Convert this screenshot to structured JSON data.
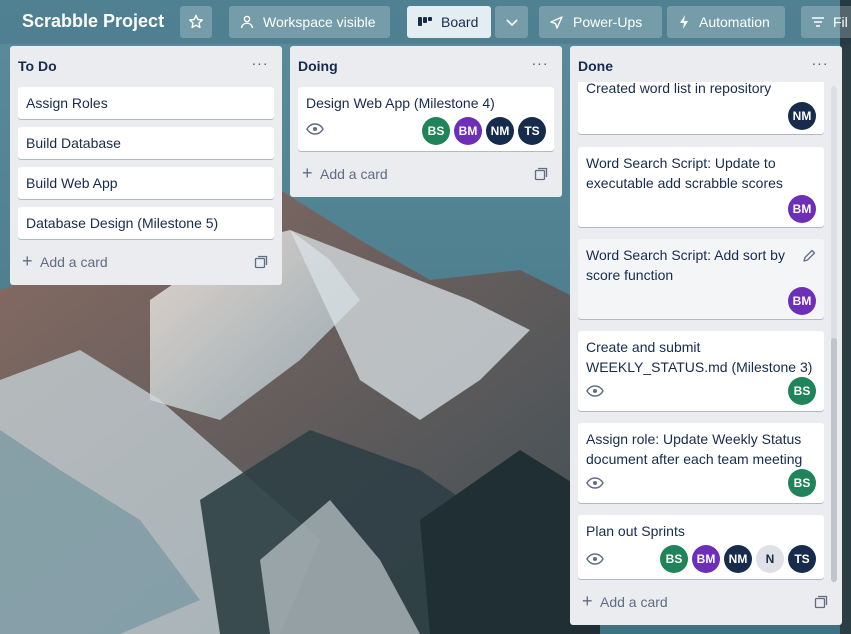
{
  "header": {
    "board_title": "Scrabble Project",
    "star_icon": "star-icon",
    "workspace_label": "Workspace visible",
    "board_label": "Board",
    "powerups_label": "Power-Ups",
    "automation_label": "Automation",
    "filter_label": "Fil"
  },
  "lists": {
    "todo": {
      "title": "To Do",
      "menu": "···",
      "cards": [
        "Assign Roles",
        "Build Database",
        "Build Web App",
        "Database Design (Milestone 5)"
      ],
      "add_card": "Add a card"
    },
    "doing": {
      "title": "Doing",
      "menu": "···",
      "cards": [
        {
          "text": "Design Web App (Milestone 4)",
          "members": [
            "BS",
            "BM",
            "NM",
            "TS"
          ]
        }
      ],
      "add_card": "Add a card"
    },
    "done": {
      "title": "Done",
      "menu": "···",
      "cards": [
        {
          "text": "Created word list in repository",
          "members": [
            "NM"
          ]
        },
        {
          "text": "Word Search Script: Update to executable add scrabble scores",
          "members": [
            "BM"
          ]
        },
        {
          "text": "Word Search Script: Add sort by score function",
          "members": [
            "BM"
          ]
        },
        {
          "text": "Create and submit WEEKLY_STATUS.md (Milestone 3)",
          "members": [
            "BS"
          ]
        },
        {
          "text": "Assign role: Update Weekly Status document after each team meeting",
          "members": [
            "BS"
          ]
        },
        {
          "text": "Plan out Sprints",
          "members": [
            "BS",
            "BM",
            "NM",
            "N",
            "TS"
          ]
        }
      ],
      "add_card": "Add a card"
    }
  },
  "member_colors": {
    "BS": "#1f845a",
    "BM": "#6e2fb8",
    "NM": "#172b4d",
    "TS": "#172b4d",
    "N": "#dfe1e6"
  }
}
